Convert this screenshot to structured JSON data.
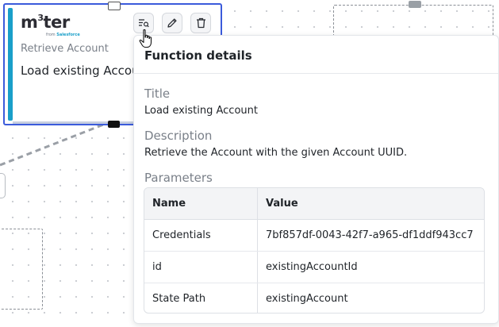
{
  "node": {
    "logo": {
      "word_part1": "m",
      "sup": "3",
      "word_part2": "ter",
      "from_label": "from",
      "from_brand": "Salesforce"
    },
    "subtitle": "Retrieve Account",
    "title": "Load existing Account"
  },
  "toolbar": {
    "details_icon": "details-list-icon",
    "edit_icon": "pencil-icon",
    "delete_icon": "trash-icon"
  },
  "popover": {
    "heading": "Function details",
    "title_label": "Title",
    "title_value": "Load existing Account",
    "description_label": "Description",
    "description_value": "Retrieve the Account with the given Account UUID.",
    "parameters_label": "Parameters",
    "columns": [
      "Name",
      "Value"
    ],
    "rows": [
      {
        "name": "Credentials",
        "value": "7bf857df-0043-42f7-a965-df1ddf943cc7"
      },
      {
        "name": "id",
        "value": "existingAccountId"
      },
      {
        "name": "State Path",
        "value": "existingAccount"
      }
    ]
  },
  "colors": {
    "selection_border": "#3b5bdb",
    "accent_bar": "#1a9fc9",
    "text_primary": "#1f2328",
    "text_muted": "#7a8089"
  }
}
